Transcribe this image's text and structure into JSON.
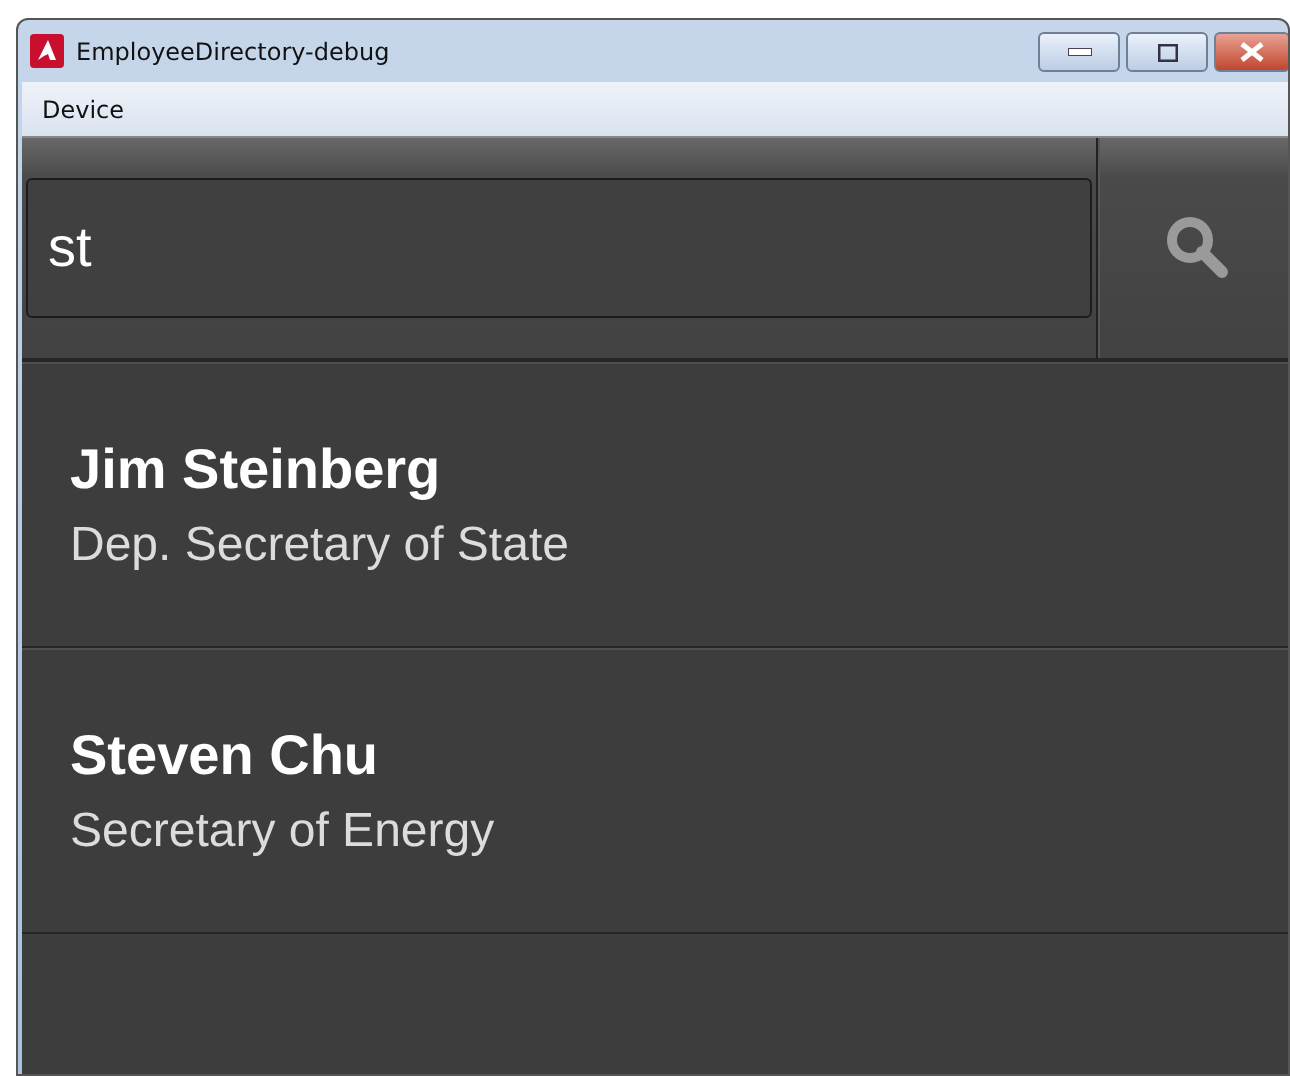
{
  "window": {
    "title": "EmployeeDirectory-debug"
  },
  "menu": [
    "Device"
  ],
  "search": {
    "value": "st"
  },
  "employees": [
    {
      "name": "Jim Steinberg",
      "title": "Dep. Secretary of State"
    },
    {
      "name": "Steven Chu",
      "title": "Secretary of Energy"
    }
  ]
}
